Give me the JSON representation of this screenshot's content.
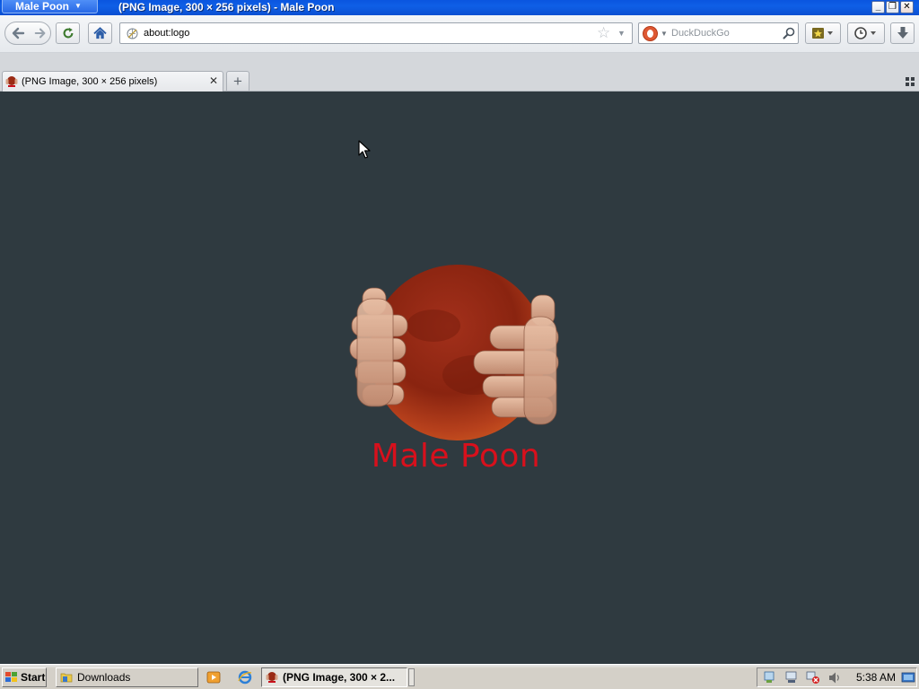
{
  "titlebar": {
    "app_menu_label": "Male Poon",
    "window_title": "(PNG Image, 300 × 256 pixels) - Male Poon",
    "minimize_glyph": "_",
    "maximize_glyph": "❐",
    "close_glyph": "✕"
  },
  "navbar": {
    "back_icon": "back-arrow-icon",
    "forward_icon": "forward-arrow-icon",
    "url": "about:logo",
    "search_engine": "DuckDuckGo",
    "search_placeholder": "DuckDuckGo"
  },
  "tabs": [
    {
      "label": "(PNG Image, 300 × 256 pixels)",
      "active": true
    }
  ],
  "new_tab_glyph": "+",
  "content": {
    "logo_text": "Male Poon",
    "background_color": "#2f3a40",
    "logo_text_color": "#d8101c"
  },
  "taskbar": {
    "start_label": "Start",
    "tasks": [
      {
        "label": "Downloads"
      },
      {
        "label": "(PNG Image, 300 × 2..."
      }
    ],
    "clock": "5:38 AM"
  }
}
